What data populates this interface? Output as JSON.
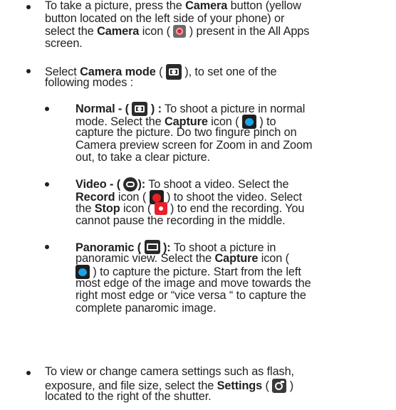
{
  "items": [
    {
      "lines": [
        [
          "To take a picture, press the ",
          {
            "b": "Camera"
          },
          " button (yellow"
        ],
        [
          "button located on the left side of your phone) or"
        ],
        [
          "select the ",
          {
            "b": "Camera"
          },
          " icon ( ",
          {
            "icon": "camera-app-icon"
          },
          " ) present in the All Apps"
        ],
        [
          "screen."
        ]
      ]
    },
    {
      "lines": [
        [
          "Select ",
          {
            "b": "Camera mode"
          },
          " ( ",
          {
            "icon": "camera-mode-icon"
          },
          " ), to set one of the"
        ],
        [
          "following modes :"
        ]
      ]
    },
    {
      "sub": true,
      "lines": [
        [
          {
            "b": "Normal - ( "
          },
          {
            "icon": "normal-mode-icon"
          },
          {
            "b": " ) :"
          },
          " To shoot a picture in normal"
        ],
        [
          "mode. Select the ",
          {
            "b": "Capture"
          },
          " icon ( ",
          {
            "icon": "capture-icon"
          },
          " ) to"
        ],
        [
          "capture the picture. Do two fingure pinch on"
        ],
        [
          "Camera preview screen for Zoom in and Zoom"
        ],
        [
          "out, to take a clear picture."
        ]
      ]
    },
    {
      "sub": true,
      "lines": [
        [
          {
            "b": "Video - ( "
          },
          {
            "icon": "video-mode-icon"
          },
          {
            "b": "):"
          },
          " To shoot a video. Select the"
        ],
        [
          {
            "b": "Record"
          },
          " icon ( ",
          {
            "icon": "record-icon"
          },
          " ) to shoot the video. Select"
        ],
        [
          "the ",
          {
            "b": "Stop"
          },
          " icon ( ",
          {
            "icon": "stop-icon"
          },
          " ) to end the recording. You"
        ],
        [
          "cannot pause the recording in the middle."
        ]
      ]
    },
    {
      "sub": true,
      "lines": [
        [
          {
            "b": "Panoramic ( "
          },
          {
            "icon": "panoramic-mode-icon"
          },
          {
            "b": " ):"
          },
          " To shoot a picture in"
        ],
        [
          "panoramic view. Select the ",
          {
            "b": "Capture"
          },
          " icon ("
        ],
        [
          {
            "icon": "capture-icon"
          },
          " ) to capture the picture. Start from the left"
        ],
        [
          "most edge of the image and move towards the"
        ],
        [
          "right most edge or “vice versa “ to capture the"
        ],
        [
          "complete panaromic image."
        ]
      ]
    },
    {
      "lines": [
        [
          "To view or change camera settings such as flash,"
        ],
        [
          "exposure, and file size, select the ",
          {
            "b": "Settings"
          },
          " ( ",
          {
            "icon": "settings-icon"
          },
          " )"
        ],
        [
          "located to the right of the shutter."
        ]
      ]
    }
  ]
}
